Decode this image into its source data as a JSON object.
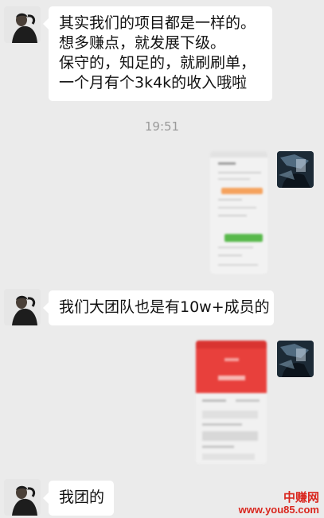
{
  "messages": {
    "m1": {
      "sender": "other",
      "lines": [
        "其实我们的项目都是一样的。",
        "想多赚点，就发展下级。",
        "保守的，知足的，就刷刷单，",
        "一个月有个3k4k的收入哦啦"
      ]
    },
    "time": "19:51",
    "m2": {
      "sender": "self",
      "type": "image-screenshot-blurred"
    },
    "m3": {
      "sender": "other",
      "text": "我们大团队也是有10w+成员的"
    },
    "m4": {
      "sender": "self",
      "type": "image-red-screenshot-blurred"
    },
    "m5": {
      "sender": "other",
      "text": "我团的"
    }
  },
  "watermark": {
    "brand": "中赚网",
    "url": "www.you85.com"
  },
  "colors": {
    "background": "#ebebeb",
    "bubble": "#ffffff",
    "accent_red": "#d9271e",
    "wechat_green": "#58b94b",
    "orange": "#f5a25d"
  }
}
